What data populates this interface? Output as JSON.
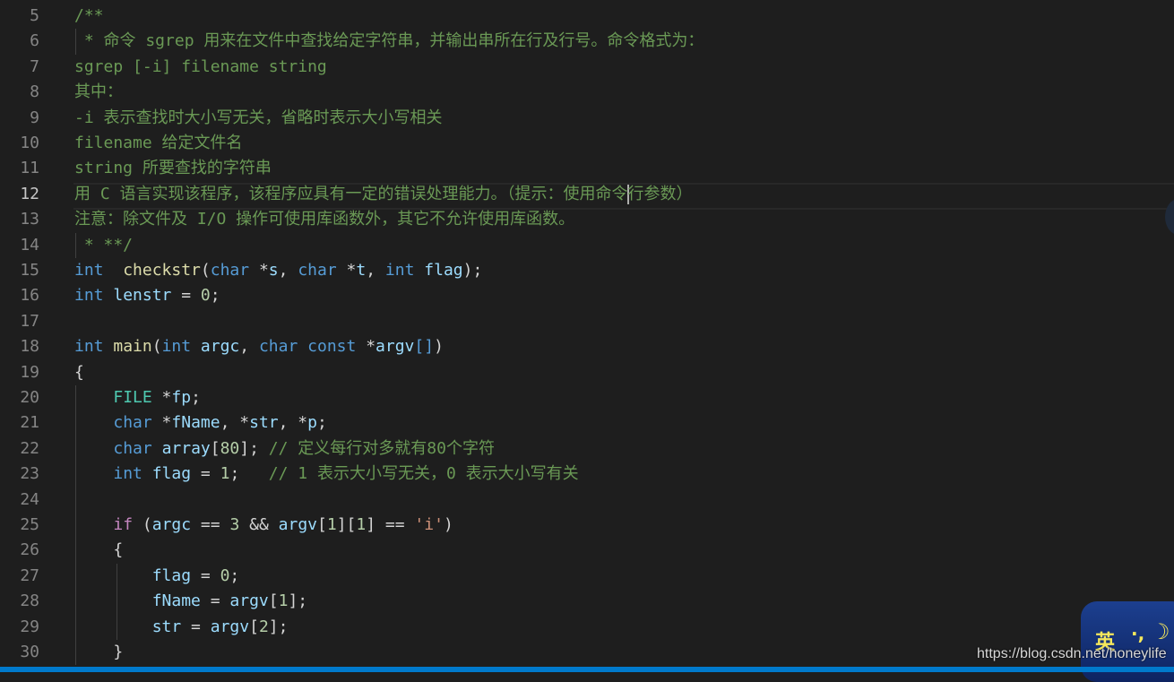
{
  "editor": {
    "language": "c",
    "active_line": 12,
    "lines": [
      {
        "n": "5",
        "tokens": [
          [
            "c",
            "/**"
          ]
        ]
      },
      {
        "n": "6",
        "tokens": [
          [
            "c",
            " * 命令 sgrep 用来在文件中查找给定字符串，并输出串所在行及行号。命令格式为："
          ]
        ]
      },
      {
        "n": "7",
        "tokens": [
          [
            "c",
            "sgrep [-i] filename string"
          ]
        ]
      },
      {
        "n": "8",
        "tokens": [
          [
            "c",
            "其中："
          ]
        ]
      },
      {
        "n": "9",
        "tokens": [
          [
            "c",
            "-i 表示查找时大小写无关，省略时表示大小写相关"
          ]
        ]
      },
      {
        "n": "10",
        "tokens": [
          [
            "c",
            "filename 给定文件名"
          ]
        ]
      },
      {
        "n": "11",
        "tokens": [
          [
            "c",
            "string 所要查找的字符串"
          ]
        ]
      },
      {
        "n": "12",
        "tokens": [
          [
            "c",
            "用 C 语言实现该程序，该程序应具有一定的错误处理能力。（提示：使用命令"
          ],
          [
            "caret",
            ""
          ],
          [
            "c",
            "行参数）"
          ]
        ]
      },
      {
        "n": "13",
        "tokens": [
          [
            "c",
            "注意：除文件及 I/O 操作可使用库函数外，其它不允许使用库函数。"
          ]
        ]
      },
      {
        "n": "14",
        "tokens": [
          [
            "c",
            " * **/"
          ]
        ]
      },
      {
        "n": "15",
        "tokens": [
          [
            "k",
            "int"
          ],
          [
            "",
            "  "
          ],
          [
            "f",
            "checkstr"
          ],
          [
            "",
            "("
          ],
          [
            "k",
            "char"
          ],
          [
            "",
            " *"
          ],
          [
            "v",
            "s"
          ],
          [
            "",
            ", "
          ],
          [
            "k",
            "char"
          ],
          [
            "",
            " *"
          ],
          [
            "v",
            "t"
          ],
          [
            "",
            ", "
          ],
          [
            "k",
            "int"
          ],
          [
            "",
            " "
          ],
          [
            "v",
            "flag"
          ],
          [
            "",
            ");"
          ]
        ]
      },
      {
        "n": "16",
        "tokens": [
          [
            "k",
            "int"
          ],
          [
            "",
            " "
          ],
          [
            "v",
            "lenstr"
          ],
          [
            "",
            " = "
          ],
          [
            "n",
            "0"
          ],
          [
            "",
            ";"
          ]
        ]
      },
      {
        "n": "17",
        "tokens": []
      },
      {
        "n": "18",
        "tokens": [
          [
            "k",
            "int"
          ],
          [
            "",
            " "
          ],
          [
            "f",
            "main"
          ],
          [
            "",
            "("
          ],
          [
            "k",
            "int"
          ],
          [
            "",
            " "
          ],
          [
            "v",
            "argc"
          ],
          [
            "",
            ", "
          ],
          [
            "k",
            "char"
          ],
          [
            "",
            " "
          ],
          [
            "k",
            "const"
          ],
          [
            "",
            " *"
          ],
          [
            "v",
            "argv"
          ],
          [
            "k",
            "[]"
          ],
          [
            "",
            ")"
          ]
        ]
      },
      {
        "n": "19",
        "tokens": [
          [
            "",
            "{"
          ]
        ]
      },
      {
        "n": "20",
        "tokens": [
          [
            "",
            "    "
          ],
          [
            "t",
            "FILE"
          ],
          [
            "",
            " *"
          ],
          [
            "v",
            "fp"
          ],
          [
            "",
            ";"
          ]
        ]
      },
      {
        "n": "21",
        "tokens": [
          [
            "",
            "    "
          ],
          [
            "k",
            "char"
          ],
          [
            "",
            " *"
          ],
          [
            "v",
            "fName"
          ],
          [
            "",
            ", *"
          ],
          [
            "v",
            "str"
          ],
          [
            "",
            ", *"
          ],
          [
            "v",
            "p"
          ],
          [
            "",
            ";"
          ]
        ]
      },
      {
        "n": "22",
        "tokens": [
          [
            "",
            "    "
          ],
          [
            "k",
            "char"
          ],
          [
            "",
            " "
          ],
          [
            "v",
            "array"
          ],
          [
            "",
            "["
          ],
          [
            "n",
            "80"
          ],
          [
            "",
            "]; "
          ],
          [
            "c",
            "// 定义每行对多就有80个字符"
          ]
        ]
      },
      {
        "n": "23",
        "tokens": [
          [
            "",
            "    "
          ],
          [
            "k",
            "int"
          ],
          [
            "",
            " "
          ],
          [
            "v",
            "flag"
          ],
          [
            "",
            " = "
          ],
          [
            "n",
            "1"
          ],
          [
            "",
            ";   "
          ],
          [
            "c",
            "// 1 表示大小写无关，0 表示大小写有关"
          ]
        ]
      },
      {
        "n": "24",
        "tokens": []
      },
      {
        "n": "25",
        "tokens": [
          [
            "",
            "    "
          ],
          [
            "p",
            "if"
          ],
          [
            "",
            " ("
          ],
          [
            "v",
            "argc"
          ],
          [
            "",
            " == "
          ],
          [
            "n",
            "3"
          ],
          [
            "",
            " && "
          ],
          [
            "v",
            "argv"
          ],
          [
            "",
            "["
          ],
          [
            "n",
            "1"
          ],
          [
            "",
            "]["
          ],
          [
            "n",
            "1"
          ],
          [
            "",
            "] == "
          ],
          [
            "s",
            "'i'"
          ],
          [
            "",
            ")"
          ]
        ]
      },
      {
        "n": "26",
        "tokens": [
          [
            "",
            "    {"
          ]
        ]
      },
      {
        "n": "27",
        "tokens": [
          [
            "",
            "        "
          ],
          [
            "v",
            "flag"
          ],
          [
            "",
            " = "
          ],
          [
            "n",
            "0"
          ],
          [
            "",
            ";"
          ]
        ]
      },
      {
        "n": "28",
        "tokens": [
          [
            "",
            "        "
          ],
          [
            "v",
            "fName"
          ],
          [
            "",
            " = "
          ],
          [
            "v",
            "argv"
          ],
          [
            "",
            "["
          ],
          [
            "n",
            "1"
          ],
          [
            "",
            "];"
          ]
        ]
      },
      {
        "n": "29",
        "tokens": [
          [
            "",
            "        "
          ],
          [
            "v",
            "str"
          ],
          [
            "",
            " = "
          ],
          [
            "v",
            "argv"
          ],
          [
            "",
            "["
          ],
          [
            "n",
            "2"
          ],
          [
            "",
            "];"
          ]
        ]
      },
      {
        "n": "30",
        "tokens": [
          [
            "",
            "    }"
          ]
        ]
      }
    ]
  },
  "ime": {
    "mode_label": "英",
    "punct": "·,",
    "moon_icon": "☽"
  },
  "watermark": "https://blog.csdn.net/honeylife",
  "colors": {
    "background": "#1e1e1e",
    "statusbar": "#007acc",
    "comment": "#6a9955",
    "keyword": "#569cd6"
  }
}
